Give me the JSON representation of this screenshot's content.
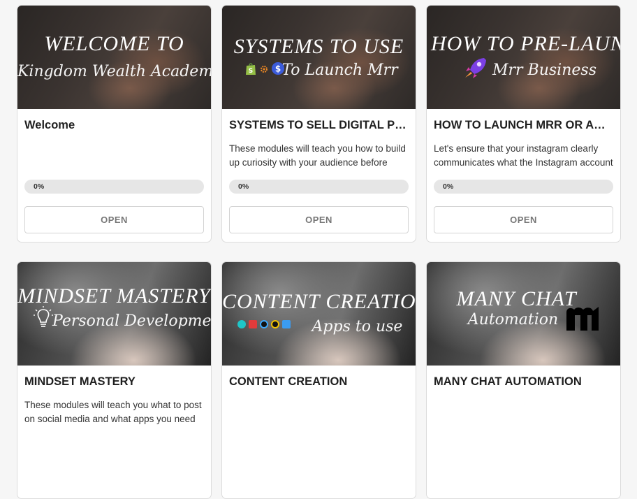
{
  "cards": [
    {
      "hero_line1": "WELCOME TO",
      "hero_line2": "Kingdom Wealth Academy",
      "title": "Welcome",
      "description": "",
      "progress": "0%",
      "button": "OPEN"
    },
    {
      "hero_line1": "SYSTEMS TO USE",
      "hero_line2": "To Launch Mrr",
      "title": "SYSTEMS TO SELL DIGITAL PRODUCTS",
      "description": "These modules will teach you how to build up curiosity with your audience before",
      "progress": "0%",
      "button": "OPEN"
    },
    {
      "hero_line1": "HOW TO PRE-LAUNCH",
      "hero_line2": "Mrr Business",
      "title": "HOW TO LAUNCH MRR OR ANY BUSINESS",
      "description": "Let's ensure that your instagram clearly communicates what the Instagram account",
      "progress": "0%",
      "button": "OPEN"
    },
    {
      "hero_line1": "MINDSET MASTERY",
      "hero_line2": "Personal Development",
      "title": "MINDSET MASTERY",
      "description": "These modules will teach you what to post on social media and what apps you need to"
    },
    {
      "hero_line1": "CONTENT CREATION",
      "hero_line2": "Apps to use",
      "title": "CONTENT CREATION",
      "description": ""
    },
    {
      "hero_line1": "MANY CHAT",
      "hero_line2": "Automation",
      "title": "MANY CHAT AUTOMATION",
      "description": ""
    }
  ],
  "icons": {
    "card2": [
      "shopify-icon",
      "gear-icon",
      "dollar-icon"
    ],
    "card3": [
      "rocket-icon"
    ],
    "card4": [
      "lightbulb-icon"
    ],
    "card5": [
      "canva-icon",
      "capcut-icon",
      "app-icon",
      "lightroom-icon",
      "capcut-alt-icon"
    ],
    "card6": [
      "manychat-logo-icon"
    ]
  },
  "colors": {
    "accent": "#5a2bd8",
    "shopify": "#95bf47",
    "dollar": "#3b5bdb"
  }
}
